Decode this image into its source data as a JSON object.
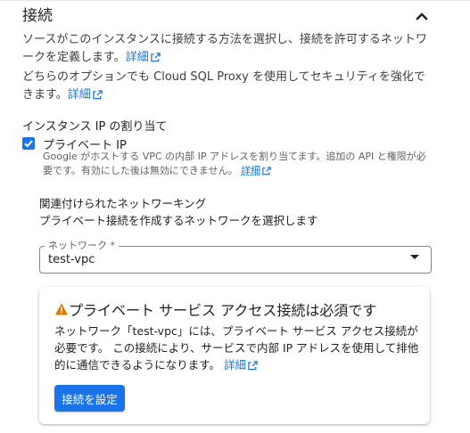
{
  "section": {
    "title": "接続",
    "collapse_icon": "chevron-up-icon"
  },
  "intro": {
    "text1": "ソースがこのインスタンスに接続する方法を選択し、接続を許可するネットワークを定義します。",
    "link1": "詳細",
    "text2": "どちらのオプションでも Cloud SQL Proxy を使用してセキュリティを強化できます。",
    "link2": "詳細"
  },
  "ip_assignment": {
    "label": "インスタンス IP の割り当て",
    "private_ip": {
      "label": "プライベート IP",
      "checked": true,
      "help": "Google がホストする VPC の内部 IP アドレスを割り当てます。追加の API と権限が必要です。有効にした後は無効にできません。",
      "link": "詳細"
    }
  },
  "networking": {
    "title": "関連付けられたネットワーキング",
    "description": "プライベート接続を作成するネットワークを選択します",
    "select": {
      "label": "ネットワーク *",
      "value": "test-vpc"
    }
  },
  "warning_card": {
    "title": "プライベート サービス アクセス接続は必須です",
    "body": "ネットワーク「test-vpc」には、プライベート サービス アクセス接続が必要です。 この接続により、サービスで内部 IP アドレスを使用して排他的に通信できるようになります。",
    "link": "詳細",
    "button": "接続を設定",
    "icon": "warning-icon"
  },
  "colors": {
    "accent": "#1a73e8",
    "warning": "#e37400",
    "text": "#202124",
    "muted": "#5f6368"
  }
}
